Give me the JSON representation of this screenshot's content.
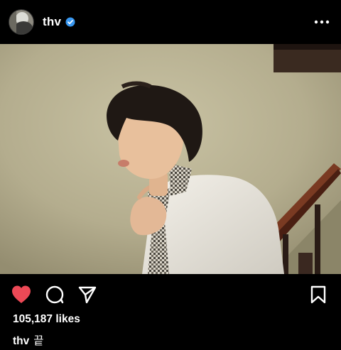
{
  "post": {
    "username": "thv",
    "likes_text": "105,187 likes",
    "caption_text": "끝",
    "liked": true
  },
  "icons": {
    "avatar": "profile-avatar",
    "verified": "verified-badge-icon",
    "more": "more-options-icon",
    "like": "heart-icon",
    "comment": "comment-icon",
    "share": "send-icon",
    "save": "bookmark-icon"
  },
  "colors": {
    "like": "#ED4956",
    "verified": "#3897F0",
    "background": "#000000"
  }
}
